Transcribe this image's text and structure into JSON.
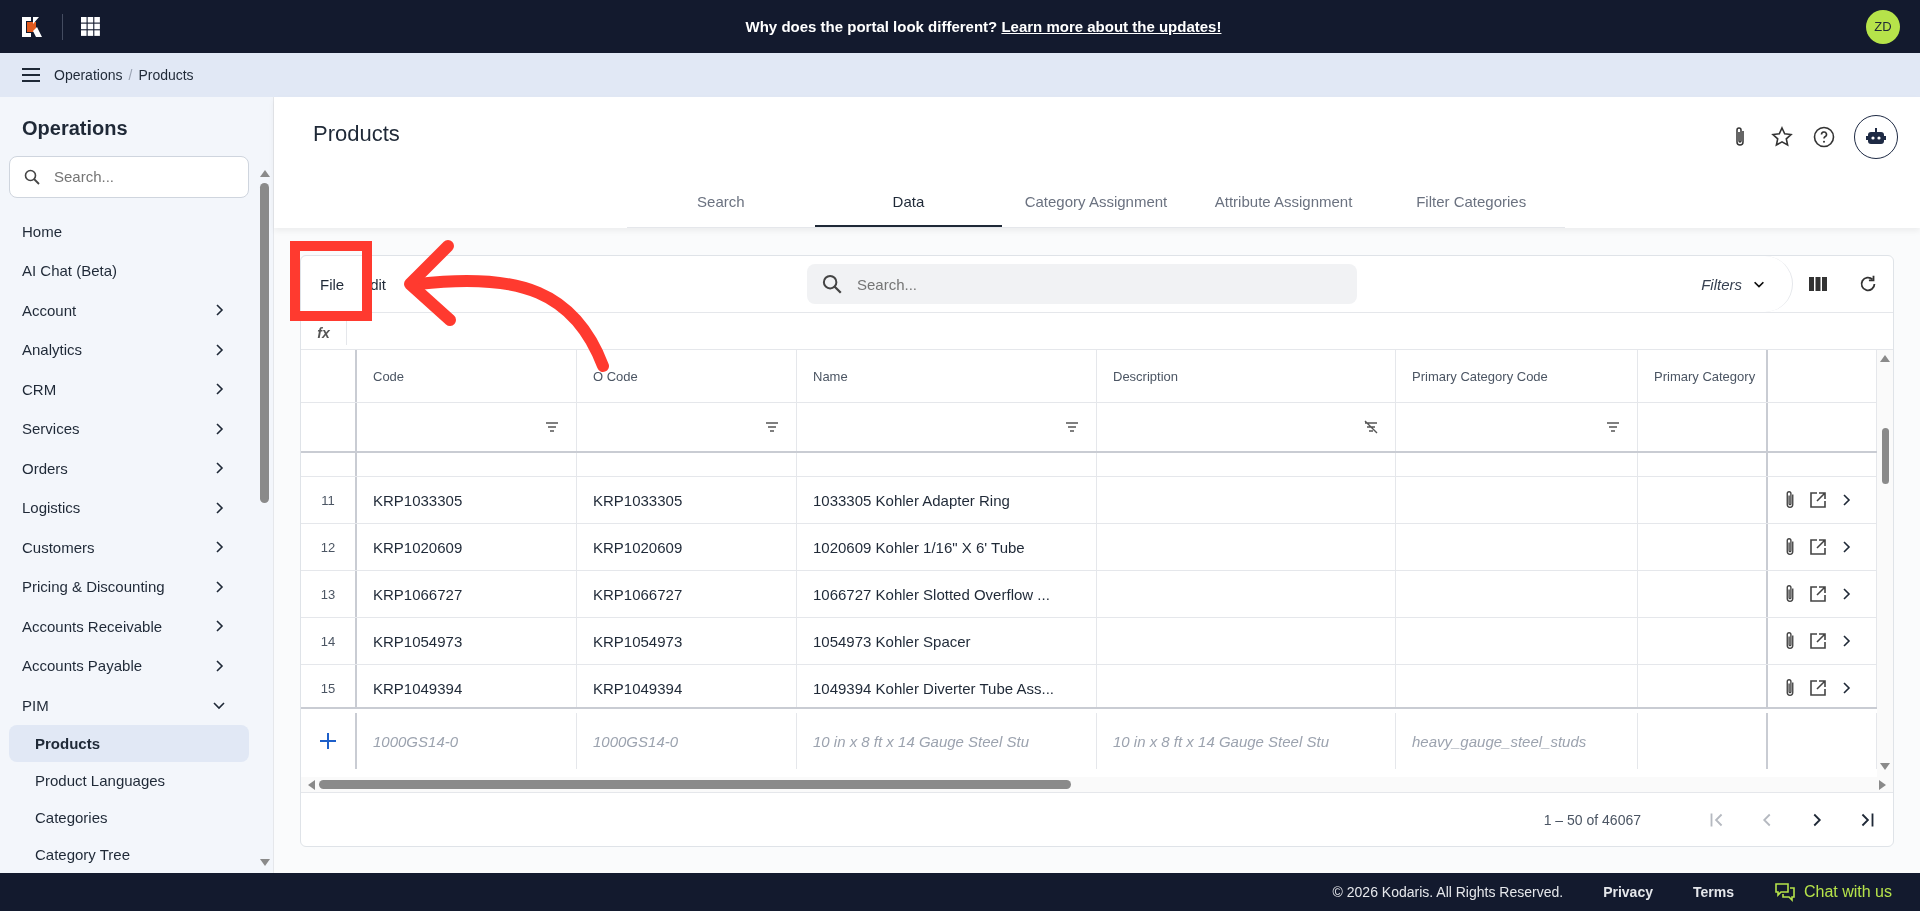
{
  "topbar": {
    "banner_text": "Why does the portal look different?",
    "banner_link": "Learn more about the updates!",
    "avatar": "ZD"
  },
  "breadcrumb": {
    "items": [
      "Operations",
      "Products"
    ],
    "separator": "/"
  },
  "sidebar": {
    "title": "Operations",
    "search": {
      "placeholder": "Search..."
    },
    "items": [
      {
        "label": "Home",
        "kind": "link",
        "selected": false
      },
      {
        "label": "AI Chat (Beta)",
        "kind": "link",
        "selected": false
      },
      {
        "label": "Account",
        "kind": "group",
        "expanded": false
      },
      {
        "label": "Analytics",
        "kind": "group",
        "expanded": false
      },
      {
        "label": "CRM",
        "kind": "group",
        "expanded": false
      },
      {
        "label": "Services",
        "kind": "group",
        "expanded": false
      },
      {
        "label": "Orders",
        "kind": "group",
        "expanded": false
      },
      {
        "label": "Logistics",
        "kind": "group",
        "expanded": false
      },
      {
        "label": "Customers",
        "kind": "group",
        "expanded": false
      },
      {
        "label": "Pricing & Discounting",
        "kind": "group",
        "expanded": false
      },
      {
        "label": "Accounts Receivable",
        "kind": "group",
        "expanded": false
      },
      {
        "label": "Accounts Payable",
        "kind": "group",
        "expanded": false
      },
      {
        "label": "PIM",
        "kind": "group",
        "expanded": true,
        "children": [
          {
            "label": "Products",
            "kind": "link",
            "selected": true
          },
          {
            "label": "Product Languages",
            "kind": "link",
            "selected": false
          },
          {
            "label": "Categories",
            "kind": "link",
            "selected": false
          },
          {
            "label": "Category Tree",
            "kind": "link",
            "selected": false
          }
        ]
      }
    ]
  },
  "page": {
    "title": "Products",
    "tabs": [
      {
        "label": "Search",
        "selected": false
      },
      {
        "label": "Data",
        "selected": true
      },
      {
        "label": "Category Assignment",
        "selected": false
      },
      {
        "label": "Attribute Assignment",
        "selected": false
      },
      {
        "label": "Filter Categories",
        "selected": false
      }
    ]
  },
  "grid": {
    "menu": [
      "File",
      "dit"
    ],
    "search": {
      "placeholder": "Search..."
    },
    "filters_label": "Filters",
    "formula_label": "fx",
    "columns": [
      {
        "label": "Code",
        "filter_active": true
      },
      {
        "label": "O Code",
        "filter_active": true
      },
      {
        "label": "Name",
        "filter_active": true
      },
      {
        "label": "Description",
        "filter_active": false
      },
      {
        "label": "Primary Category Code",
        "filter_active": true
      },
      {
        "label": "Primary Category"
      }
    ],
    "rows": [
      {
        "number": "11",
        "cells": [
          "KRP1033305",
          "KRP1033305",
          "1033305 Kohler Adapter Ring",
          null,
          null,
          null
        ]
      },
      {
        "number": "12",
        "cells": [
          "KRP1020609",
          "KRP1020609",
          "1020609 Kohler 1/16\" X 6' Tube",
          null,
          null,
          null
        ]
      },
      {
        "number": "13",
        "cells": [
          "KRP1066727",
          "KRP1066727",
          "1066727 Kohler Slotted Overflow ...",
          null,
          null,
          null
        ]
      },
      {
        "number": "14",
        "cells": [
          "KRP1054973",
          "KRP1054973",
          "1054973 Kohler Spacer",
          null,
          null,
          null
        ]
      },
      {
        "number": "15",
        "cells": [
          "KRP1049394",
          "KRP1049394",
          "1049394 Kohler Diverter Tube Ass...",
          null,
          null,
          null
        ]
      }
    ],
    "new_row": {
      "cells": [
        "1000GS14-0",
        "1000GS14-0",
        "10 in x 8 ft x 14 Gauge Steel Stu",
        "10 in x 8 ft x 14 Gauge Steel Stu",
        "heavy_gauge_steel_studs",
        null
      ]
    },
    "pagination": {
      "range": "1 – 50 of 46067",
      "buttons": [
        {
          "kind": "first",
          "disabled": true
        },
        {
          "kind": "prev",
          "disabled": true
        },
        {
          "kind": "next",
          "disabled": false
        },
        {
          "kind": "last",
          "disabled": false
        }
      ]
    }
  },
  "footer": {
    "copyright": "© 2026 Kodaris. All Rights Reserved.",
    "links": [
      "Privacy",
      "Terms"
    ],
    "chat": "Chat with us"
  }
}
